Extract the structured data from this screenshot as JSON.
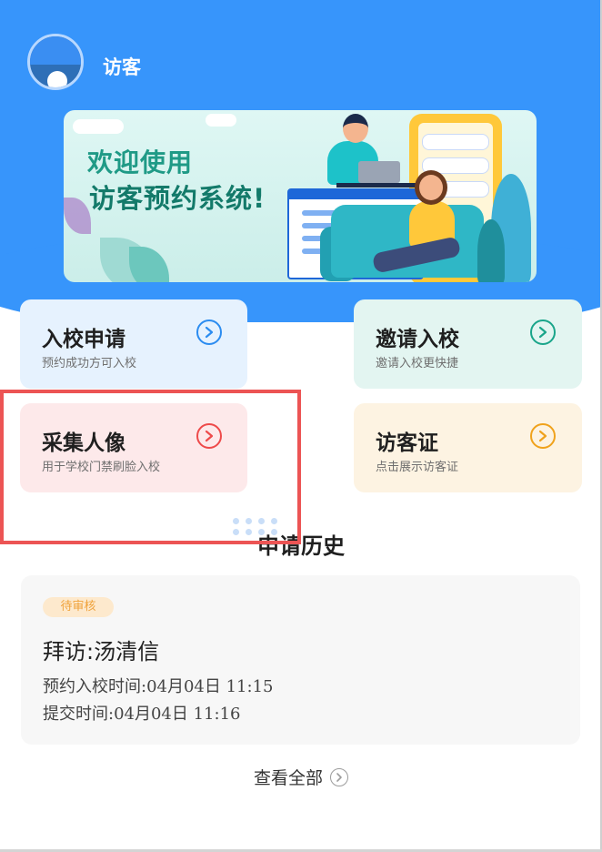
{
  "header": {
    "role_label": "访客"
  },
  "banner": {
    "line1": "欢迎使用",
    "line2": "访客预约系统!"
  },
  "cards": [
    {
      "title": "入校申请",
      "subtitle": "预约成功方可入校",
      "bg": "#e6f2fe",
      "accent": "#2b8cf0"
    },
    {
      "title": "邀请入校",
      "subtitle": "邀请入校更快捷",
      "bg": "#e3f5f1",
      "accent": "#1aa58a"
    },
    {
      "title": "采集人像",
      "subtitle": "用于学校门禁刷脸入校",
      "bg": "#fde9ea",
      "accent": "#ee4a4a"
    },
    {
      "title": "访客证",
      "subtitle": "点击展示访客证",
      "bg": "#fdf3e2",
      "accent": "#f0a21c"
    }
  ],
  "history": {
    "section_title": "申请历史",
    "records": [
      {
        "status": "待审核",
        "title": "拜访:汤清信",
        "entry_time": "预约入校时间:04月04日 11:15",
        "submit_time": "提交时间:04月04日 11:16"
      }
    ],
    "view_all": "查看全部"
  },
  "colors": {
    "header_blue": "#3795fb",
    "highlight_red": "#ec5454",
    "status_orange": "#f0a23a"
  }
}
